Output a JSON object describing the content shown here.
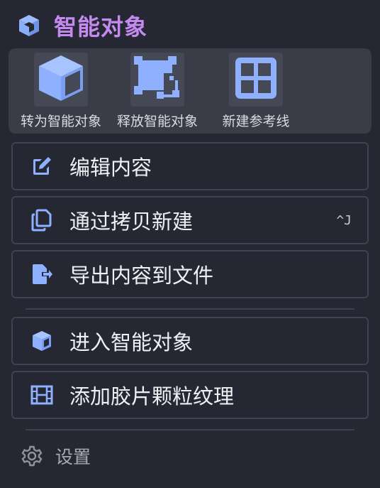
{
  "header": {
    "title": "智能对象",
    "icon": "cube-icon",
    "title_color": "#c58af0"
  },
  "toolbar": {
    "tools": [
      {
        "label": "转为智能对象",
        "icon": "cube-icon"
      },
      {
        "label": "释放智能对象",
        "icon": "release-frame-icon"
      },
      {
        "label": "新建参考线",
        "icon": "grid-icon"
      }
    ]
  },
  "menu": {
    "items": [
      {
        "label": "编辑内容",
        "icon": "edit-icon"
      },
      {
        "label": "通过拷贝新建",
        "icon": "copy-icon",
        "shortcut": "^J"
      },
      {
        "label": "导出内容到文件",
        "icon": "file-export-icon"
      },
      {
        "label": "进入智能对象",
        "icon": "cube-icon"
      },
      {
        "label": "添加胶片颗粒纹理",
        "icon": "film-icon"
      }
    ]
  },
  "settings": {
    "label": "设置",
    "icon": "gear-icon"
  },
  "colors": {
    "accent": "#8eb0ff",
    "background": "#252833",
    "panel": "#3a3d48"
  }
}
